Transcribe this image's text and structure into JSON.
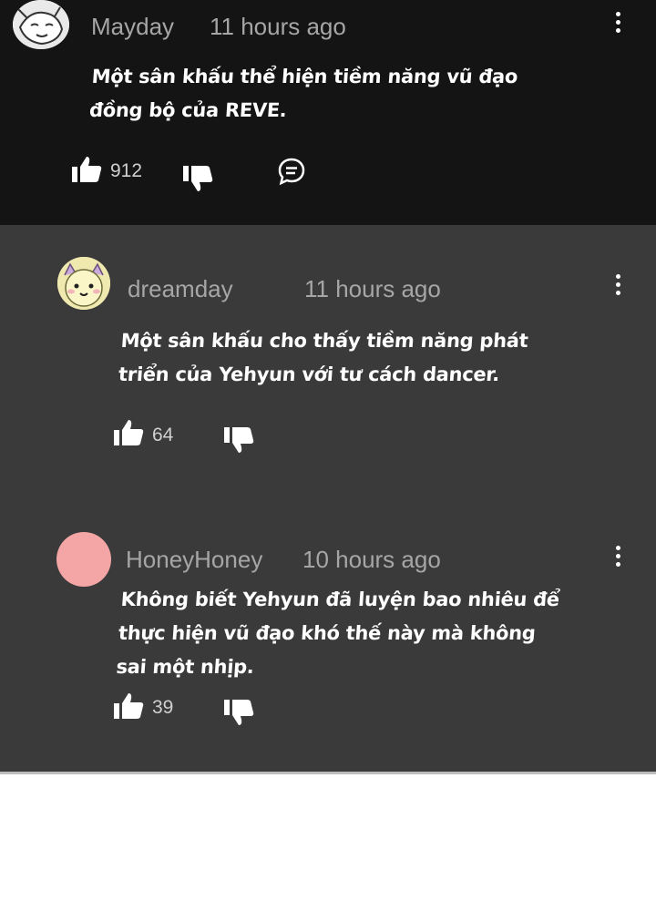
{
  "comments": [
    {
      "username": "Mayday",
      "time": "11 hours ago",
      "text_lines": [
        "Một sân khấu thể hiện tiềm năng vũ đạo",
        "đồng bộ của REVE."
      ],
      "likes": "912",
      "avatar_color": "#e8e8e8"
    },
    {
      "username": "dreamday",
      "time": "11 hours ago",
      "text_lines": [
        "Một sân khấu cho thấy tiềm năng phát",
        "triển của Yehyun với tư cách dancer."
      ],
      "likes": "64",
      "avatar_color": "#f3eea6"
    },
    {
      "username": "HoneyHoney",
      "time": "10 hours ago",
      "text_lines": [
        "Không biết Yehyun đã luyện bao nhiêu để",
        "thực hiện vũ đạo khó thế này mà không",
        "sai một nhịp."
      ],
      "likes": "39",
      "avatar_color": "#f4a5a5"
    }
  ],
  "colors": {
    "top_background": "#141414",
    "reply_background": "#3a3a3a",
    "meta_text": "#a6a6a6",
    "body_text": "#ffffff"
  }
}
